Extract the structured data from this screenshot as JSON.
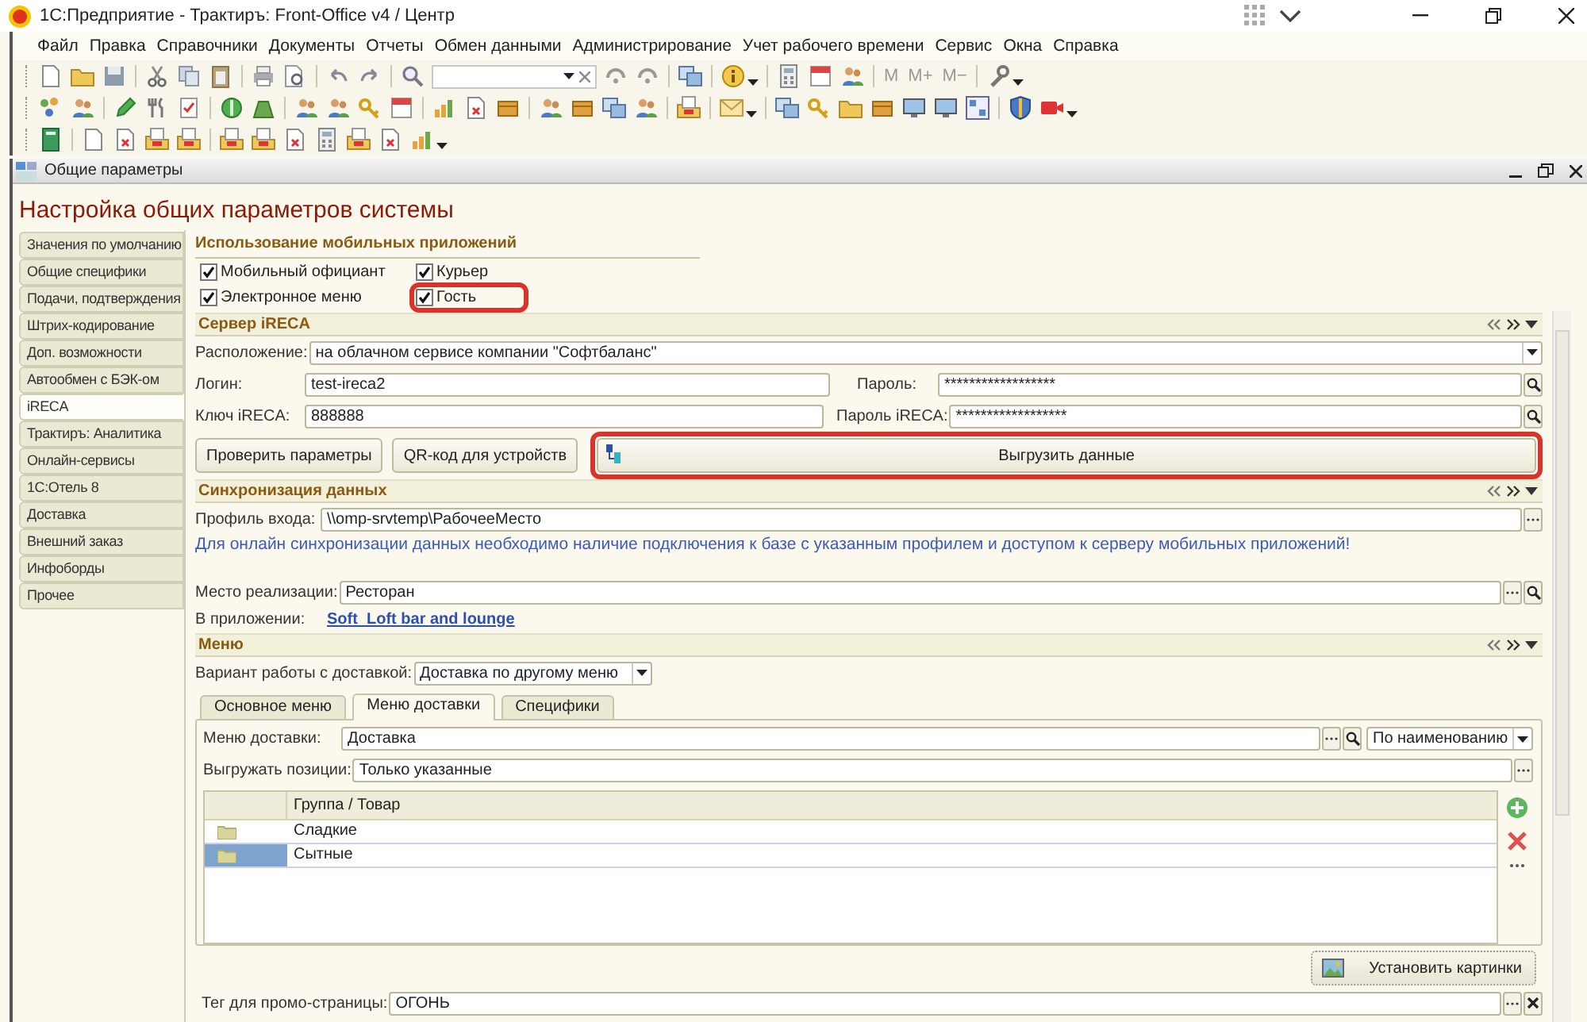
{
  "window": {
    "title": "1С:Предприятие - Трактиръ: Front-Office v4 / Центр"
  },
  "menu": [
    "Файл",
    "Правка",
    "Справочники",
    "Документы",
    "Отчеты",
    "Обмен данными",
    "Администрирование",
    "Учет рабочего времени",
    "Сервис",
    "Окна",
    "Справка"
  ],
  "memory_buttons": [
    "M",
    "M+",
    "M−"
  ],
  "form_window": {
    "title": "Общие параметры"
  },
  "heading": "Настройка общих параметров системы",
  "side_tabs": [
    {
      "label": "Значения по умолчанию",
      "selected": false
    },
    {
      "label": "Общие специфики",
      "selected": false
    },
    {
      "label": "Подачи, подтверждения",
      "selected": false
    },
    {
      "label": "Штрих-кодирование",
      "selected": false
    },
    {
      "label": "Доп. возможности",
      "selected": false
    },
    {
      "label": "Автообмен с БЭК-ом",
      "selected": false
    },
    {
      "label": "iRECA",
      "selected": true
    },
    {
      "label": "Трактиръ: Аналитика",
      "selected": false
    },
    {
      "label": "Онлайн-сервисы",
      "selected": false
    },
    {
      "label": "1С:Отель 8",
      "selected": false
    },
    {
      "label": "Доставка",
      "selected": false
    },
    {
      "label": "Внешний заказ",
      "selected": false
    },
    {
      "label": "Инфоборды",
      "selected": false
    },
    {
      "label": "Прочее",
      "selected": false
    }
  ],
  "mobile_apps": {
    "title": "Использование мобильных приложений",
    "options": [
      {
        "label": "Мобильный официант",
        "checked": true,
        "highlighted": false
      },
      {
        "label": "Курьер",
        "checked": true,
        "highlighted": false
      },
      {
        "label": "Электронное меню",
        "checked": true,
        "highlighted": false
      },
      {
        "label": "Гость",
        "checked": true,
        "highlighted": true
      }
    ]
  },
  "ireca_server": {
    "title": "Сервер iRECA",
    "location": {
      "label": "Расположение:",
      "value": "на облачном сервисе компании \"Софтбаланс\""
    },
    "login": {
      "label": "Логин:",
      "value": "test-ireca2"
    },
    "password": {
      "label": "Пароль:",
      "value": "******************"
    },
    "key": {
      "label": "Ключ iRECA:",
      "value": "888888"
    },
    "key_password": {
      "label": "Пароль iRECA:",
      "value": "******************"
    },
    "buttons": [
      {
        "label": "Проверить параметры",
        "kind": "plain",
        "highlighted": false
      },
      {
        "label": "QR-код для устройств",
        "kind": "plain",
        "highlighted": false
      },
      {
        "label": "Выгрузить данные",
        "kind": "upload",
        "highlighted": true
      }
    ]
  },
  "sync": {
    "title": "Синхронизация данных",
    "profile": {
      "label": "Профиль входа:",
      "value": "\\\\omp-srvtemp\\РабочееМесто"
    },
    "note": "Для онлайн синхронизации данных необходимо наличие подключения к базе с указанным профилем и доступом к серверу мобильных приложений!",
    "place": {
      "label": "Место реализации:",
      "value": "Ресторан"
    },
    "app": {
      "label": "В приложении:",
      "link": "Soft  Loft bar and lounge"
    }
  },
  "menu_section": {
    "title": "Меню",
    "delivery_mode": {
      "label": "Вариант работы с доставкой:",
      "value": "Доставка по другому меню"
    },
    "tabs": [
      {
        "label": "Основное меню",
        "selected": false
      },
      {
        "label": "Меню доставки",
        "selected": true
      },
      {
        "label": "Специфики",
        "selected": false
      }
    ],
    "delivery_menu": {
      "label": "Меню доставки:",
      "value": "Доставка"
    },
    "sort": {
      "value": "По наименованию"
    },
    "export_positions": {
      "label": "Выгружать позиции:",
      "value": "Только указанные"
    },
    "table": {
      "columns": [
        "Группа / Товар"
      ],
      "rows": [
        {
          "cells": [
            "Сладкие"
          ],
          "selected": false
        },
        {
          "cells": [
            "Сытные"
          ],
          "selected": true
        }
      ]
    },
    "set_pictures_button": "Установить картинки",
    "promo_tag": {
      "label": "Тег для промо-страницы:",
      "value": "ОГОНЬ"
    }
  }
}
